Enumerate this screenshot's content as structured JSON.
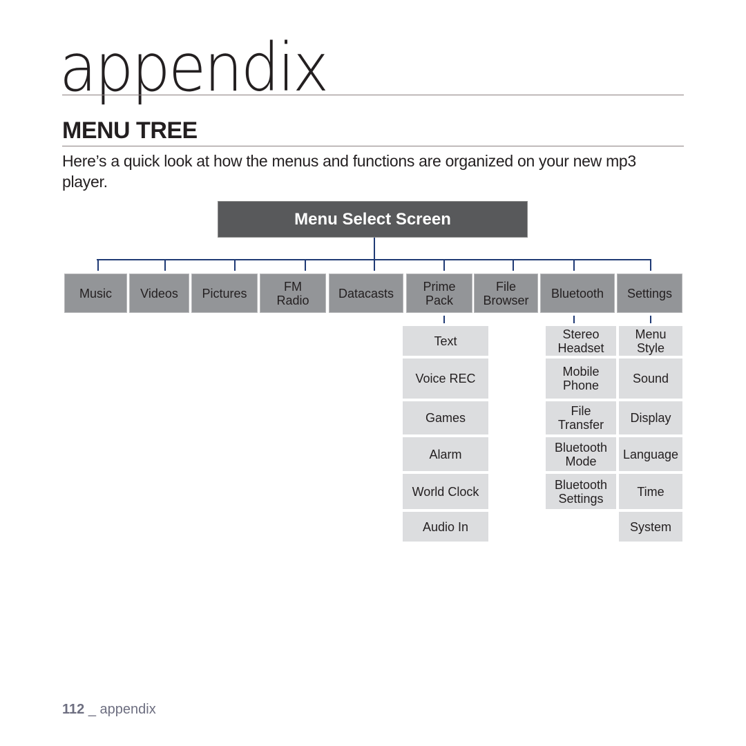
{
  "header": {
    "chapter_title": "appendix",
    "section_title": "MENU TREE",
    "intro": "Here’s a quick look at how the menus and functions are organized on your new mp3 player."
  },
  "tree": {
    "root": "Menu Select Screen",
    "top_items": [
      {
        "label": "Music"
      },
      {
        "label": "Videos"
      },
      {
        "label": "Pictures"
      },
      {
        "label": "FM\nRadio"
      },
      {
        "label": "Datacasts"
      },
      {
        "label": "Prime\nPack"
      },
      {
        "label": "File\nBrowser"
      },
      {
        "label": "Bluetooth"
      },
      {
        "label": "Settings"
      }
    ],
    "prime_pack_children": [
      "Text",
      "Voice REC",
      "Games",
      "Alarm",
      "World Clock",
      "Audio In"
    ],
    "bluetooth_children": [
      "Stereo\nHeadset",
      "Mobile\nPhone",
      "File\nTransfer",
      "Bluetooth\nMode",
      "Bluetooth\nSettings"
    ],
    "settings_children": [
      "Menu\nStyle",
      "Sound",
      "Display",
      "Language",
      "Time",
      "System"
    ]
  },
  "colors": {
    "root_fill": "#58595b",
    "top_item_fill": "#939598",
    "sub_item_fill": "#dcdddf",
    "connector": "#1f3a75"
  },
  "footer": {
    "page_number": "112",
    "separator": "_",
    "section": "appendix"
  }
}
